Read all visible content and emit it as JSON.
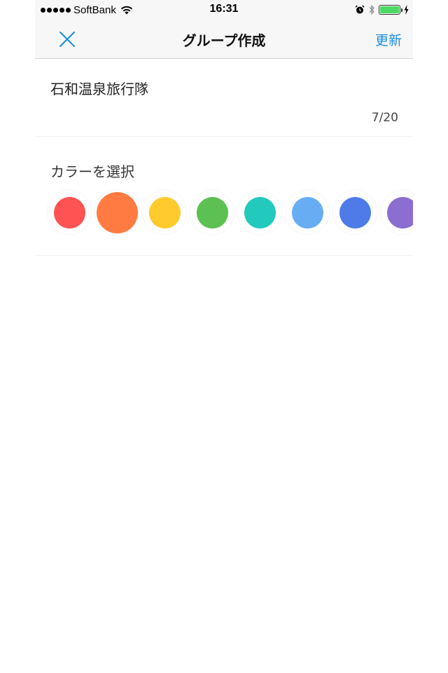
{
  "status_bar": {
    "carrier": "SoftBank",
    "time": "16:31",
    "battery_level": 1.0,
    "icons": [
      "signal-dots-icon",
      "wifi-icon",
      "alarm-icon",
      "bluetooth-icon",
      "battery-icon",
      "charging-icon"
    ]
  },
  "nav": {
    "title": "グループ作成",
    "update_label": "更新",
    "close_icon": "close-icon",
    "accent_color": "#1a8ce0"
  },
  "group": {
    "name": "石和温泉旅行隊",
    "counter": "7/20"
  },
  "colors": {
    "label": "カラーを選択",
    "selected_index": 1,
    "swatches": [
      "#ff5252",
      "#ff7b42",
      "#ffca2c",
      "#5cc052",
      "#22c9bd",
      "#66adf4",
      "#4f7be8",
      "#8c6ed2"
    ]
  }
}
